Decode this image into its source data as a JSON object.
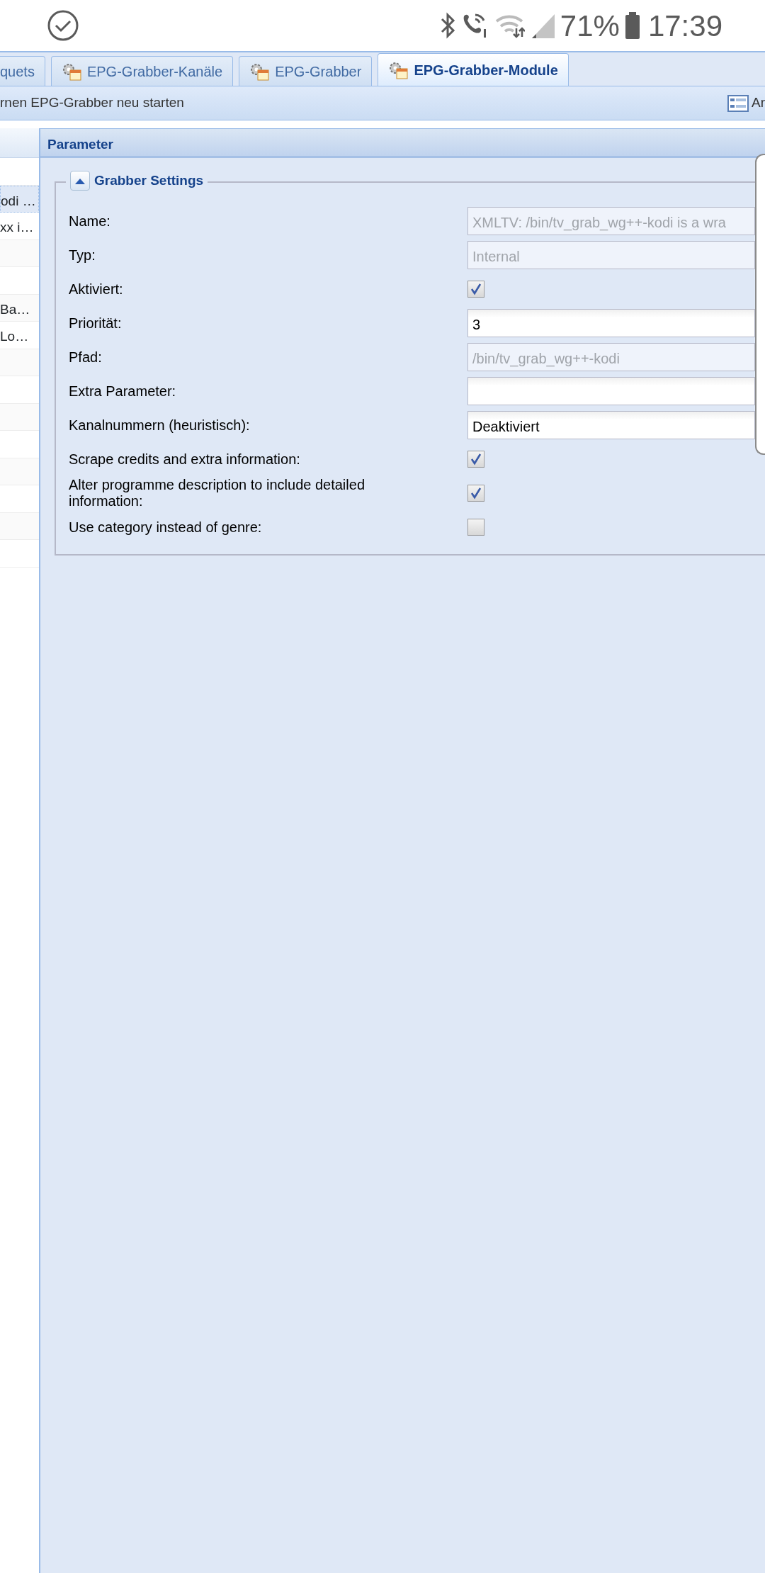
{
  "status_bar": {
    "battery": "71%",
    "time": "17:39"
  },
  "tabs": [
    {
      "label": "quets",
      "selected": false,
      "icon": false
    },
    {
      "label": "EPG-Grabber-Kanäle",
      "selected": false,
      "icon": true
    },
    {
      "label": "EPG-Grabber",
      "selected": false,
      "icon": true
    },
    {
      "label": "EPG-Grabber-Module",
      "selected": true,
      "icon": true
    }
  ],
  "toolbar": {
    "left_button": "rnen EPG-Grabber neu starten",
    "right_button": "Ar"
  },
  "grid": {
    "rows": [
      {
        "selected": false
      },
      {
        "text": "odi …",
        "selected": true
      },
      {
        "text": "xx i…",
        "selected": false
      },
      {
        "selected": false
      },
      {
        "selected": false
      },
      {
        "text": "Ba…",
        "selected": false
      },
      {
        "text": "Lo…",
        "selected": false
      },
      {
        "selected": false
      },
      {
        "selected": false
      },
      {
        "selected": false
      },
      {
        "selected": false
      },
      {
        "selected": false
      },
      {
        "selected": false
      },
      {
        "selected": false
      },
      {
        "selected": false
      }
    ]
  },
  "panel": {
    "title": "Parameter",
    "fieldset": {
      "title": "Grabber Settings",
      "expanded": true,
      "fields": [
        {
          "kind": "text",
          "label": "Name:",
          "value": "XMLTV: /bin/tv_grab_wg++-kodi is a wra",
          "disabled": true
        },
        {
          "kind": "text",
          "label": "Typ:",
          "value": "Internal",
          "disabled": true
        },
        {
          "kind": "checkbox",
          "label": "Aktiviert:",
          "checked": true
        },
        {
          "kind": "text",
          "label": "Priorität:",
          "value": "3",
          "disabled": false
        },
        {
          "kind": "text",
          "label": "Pfad:",
          "value": "/bin/tv_grab_wg++-kodi",
          "disabled": true
        },
        {
          "kind": "text",
          "label": "Extra Parameter:",
          "disabled": false
        },
        {
          "kind": "text",
          "label": "Kanalnummern (heuristisch):",
          "value": "Deaktiviert",
          "disabled": false
        },
        {
          "kind": "checkbox",
          "label": "Scrape credits and extra information:",
          "checked": true
        },
        {
          "kind": "checkbox",
          "label": "Alter programme description to include detailed information:",
          "checked": true
        },
        {
          "kind": "checkbox",
          "label": "Use category instead of genre:",
          "checked": false
        }
      ]
    }
  }
}
